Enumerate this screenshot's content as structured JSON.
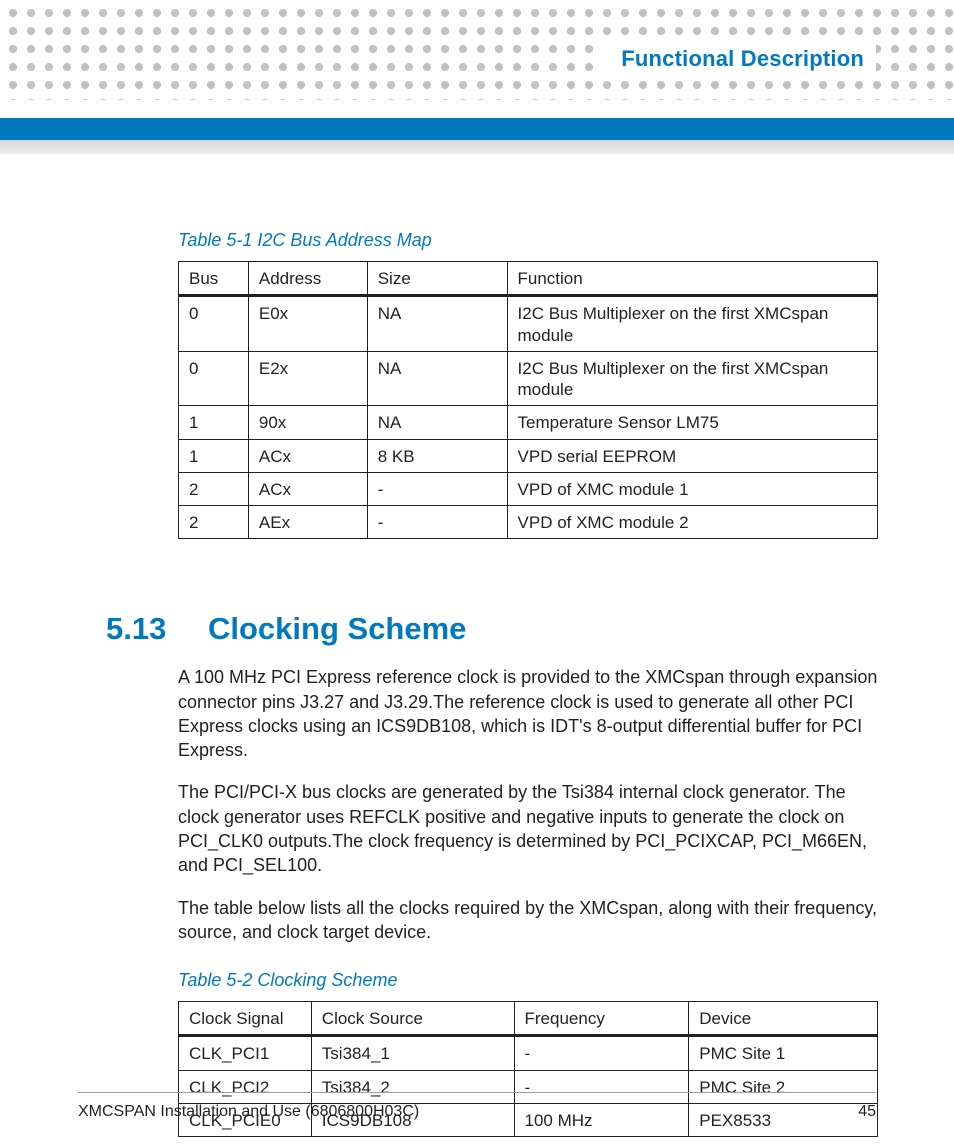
{
  "header": {
    "chapter_title": "Functional Description"
  },
  "table1": {
    "caption": "Table 5-1 I2C Bus Address Map",
    "headers": [
      "Bus",
      "Address",
      "Size",
      "Function"
    ],
    "rows": [
      {
        "c0": "0",
        "c1": "E0x",
        "c2": "NA",
        "c3": "I2C Bus Multiplexer on the first XMCspan module"
      },
      {
        "c0": "0",
        "c1": "E2x",
        "c2": "NA",
        "c3": "I2C Bus Multiplexer on the first XMCspan module"
      },
      {
        "c0": "1",
        "c1": "90x",
        "c2": "NA",
        "c3": "Temperature Sensor LM75"
      },
      {
        "c0": "1",
        "c1": "ACx",
        "c2": "8 KB",
        "c3": "VPD serial EEPROM"
      },
      {
        "c0": "2",
        "c1": "ACx",
        "c2": "-",
        "c3": "VPD of XMC module 1"
      },
      {
        "c0": "2",
        "c1": "AEx",
        "c2": "-",
        "c3": "VPD of XMC module 2"
      }
    ]
  },
  "section": {
    "number": "5.13",
    "title": "Clocking Scheme",
    "paragraphs": [
      "A 100 MHz PCI Express reference clock is provided to the XMCspan through expansion connector pins J3.27 and J3.29.The reference clock is used to generate all other PCI Express clocks using an ICS9DB108, which is IDT's 8-output differential buffer for PCI Express.",
      "The PCI/PCI-X bus clocks are generated by the Tsi384 internal clock generator. The clock generator uses REFCLK positive and negative inputs to generate the clock on PCI_CLK0 outputs.The clock frequency is determined by PCI_PCIXCAP, PCI_M66EN, and PCI_SEL100.",
      "The table below lists all the clocks required by the XMCspan, along with their frequency, source, and clock target device."
    ]
  },
  "table2": {
    "caption": "Table 5-2 Clocking Scheme",
    "headers": [
      "Clock Signal",
      "Clock Source",
      "Frequency",
      "Device"
    ],
    "rows": [
      {
        "c0": "CLK_PCI1",
        "c1": "Tsi384_1",
        "c2": "-",
        "c3": "PMC Site 1"
      },
      {
        "c0": "CLK_PCI2",
        "c1": "Tsi384_2",
        "c2": "-",
        "c3": "PMC Site 2"
      },
      {
        "c0": "CLK_PCIE0",
        "c1": "ICS9DB108",
        "c2": "100 MHz",
        "c3": "PEX8533"
      }
    ]
  },
  "footer": {
    "doc_title": "XMCSPAN Installation and Use (6806800H03C)",
    "page_number": "45"
  }
}
